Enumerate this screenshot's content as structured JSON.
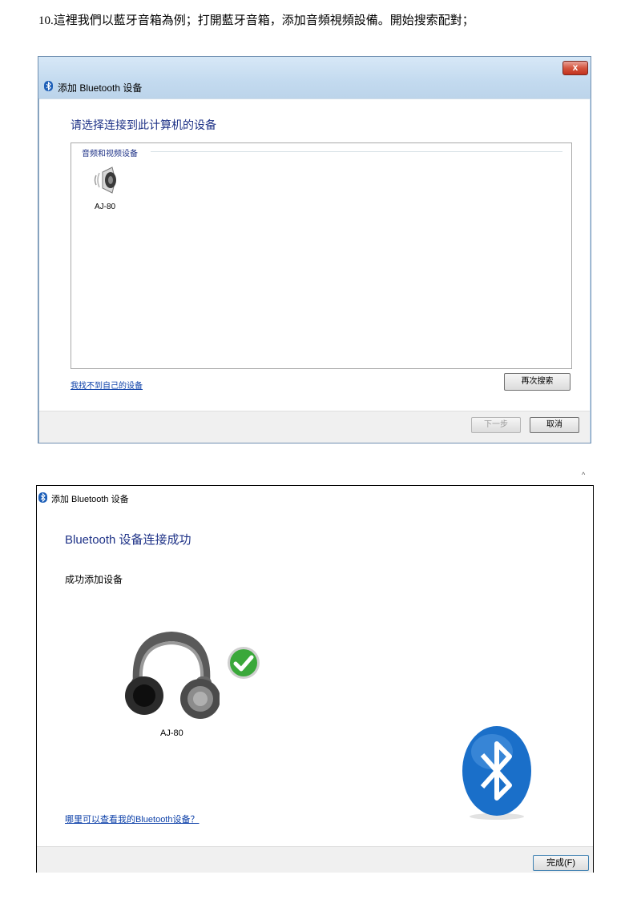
{
  "caption": "10.這裡我們以藍牙音箱為例；打開藍牙音箱，添加音頻視頻設備。開始搜索配對；",
  "window1": {
    "title": "添加 Bluetooth 设备",
    "close_label": "x",
    "heading": "请选择连接到此计算机的设备",
    "group_label": "音频和视频设备",
    "device_name": "AJ-80",
    "link_text": "我找不到自己的设备",
    "search_again_label": "再次搜索",
    "next_label": "下一步",
    "cancel_label": "取消"
  },
  "window2": {
    "title": "添加 Bluetooth 设备",
    "heading": "Bluetooth 设备连接成功",
    "subheading": "成功添加设备",
    "device_name": "AJ-80",
    "link_text": "哪里可以查看我的Bluetooth设备？",
    "finish_label": "完成(F)"
  },
  "stray_mark": "^",
  "icons": [
    "bluetooth-icon",
    "speaker-icon",
    "headphones-icon",
    "checkmark-icon",
    "bluetooth-logo-icon"
  ],
  "colors": {
    "heading": "#1e3287",
    "link": "#0b3fa8",
    "title_bar": "#c9dff2",
    "bluetooth_blue": "#1a6fc9",
    "check_green": "#3aa83a"
  }
}
